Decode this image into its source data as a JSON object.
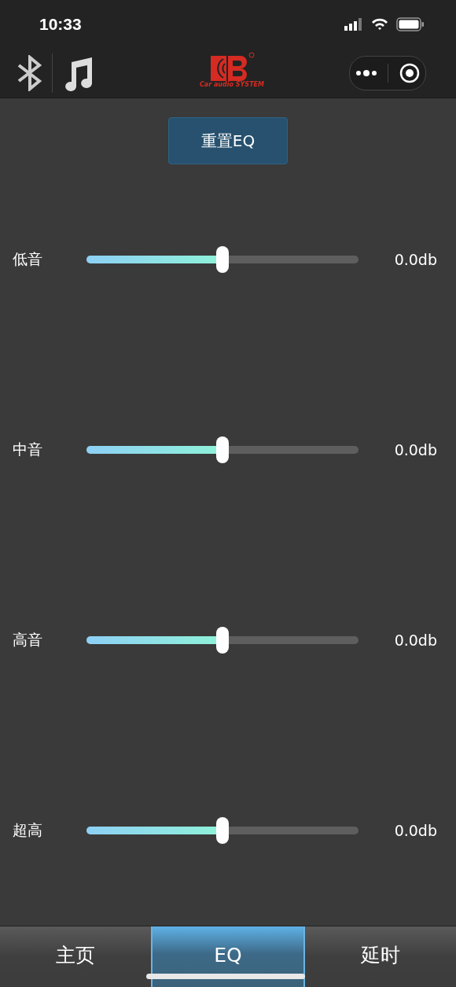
{
  "status_bar": {
    "time": "10:33"
  },
  "nav_bar": {
    "logo_text": "Car audio SYSTEM"
  },
  "reset_button": {
    "label": "重置EQ"
  },
  "bands": [
    {
      "name": "低音",
      "level": 0.5,
      "reading": "0.0db"
    },
    {
      "name": "中音",
      "level": 0.5,
      "reading": "0.0db"
    },
    {
      "name": "高音",
      "level": 0.5,
      "reading": "0.0db"
    },
    {
      "name": "超高",
      "level": 0.5,
      "reading": "0.0db"
    }
  ],
  "tabs": [
    {
      "label": "主页",
      "selected": false
    },
    {
      "label": "EQ",
      "selected": true
    },
    {
      "label": "延时",
      "selected": false
    }
  ]
}
